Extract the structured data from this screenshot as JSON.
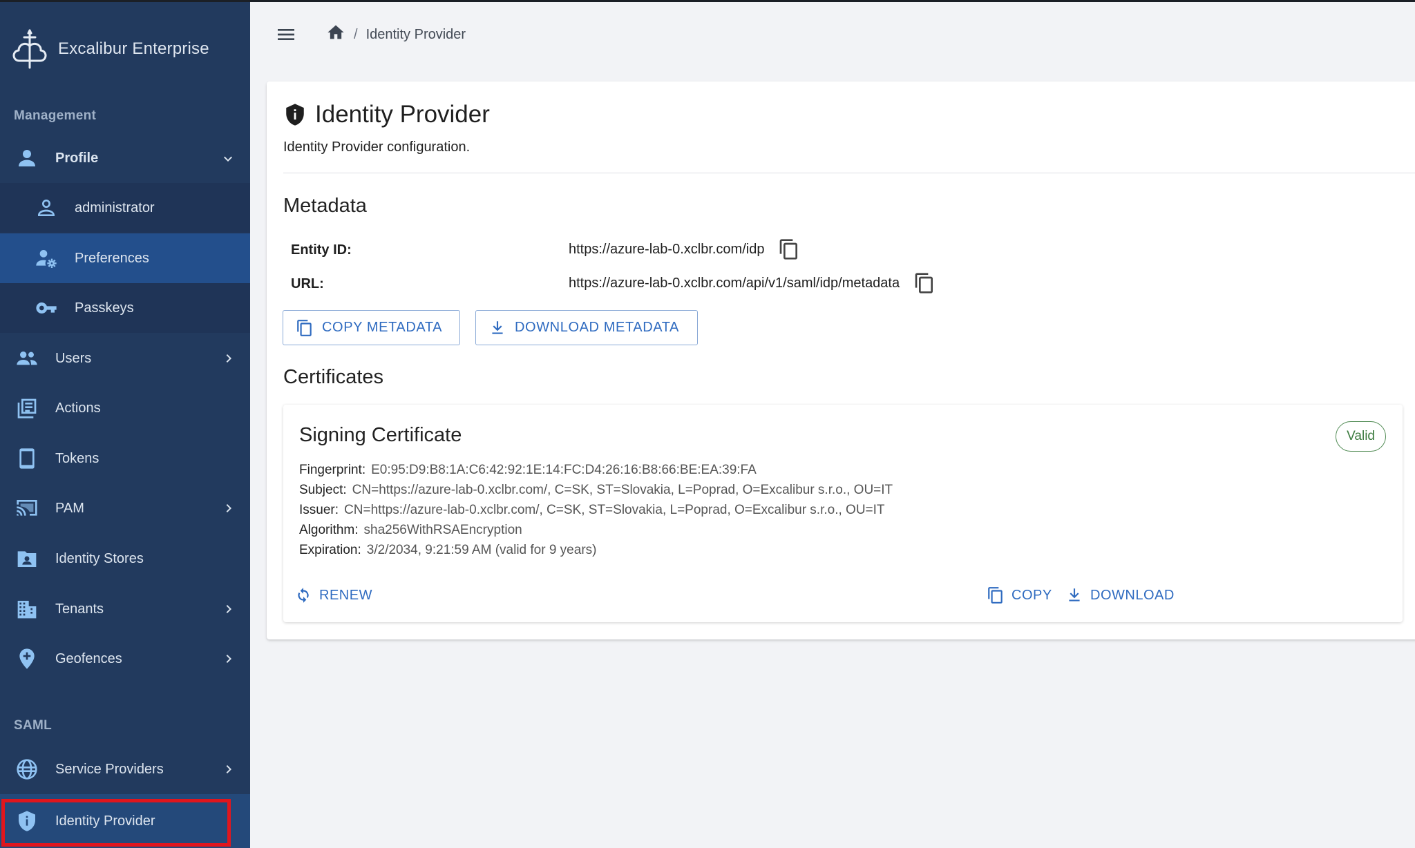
{
  "app": {
    "name": "Excalibur Enterprise"
  },
  "sidebar": {
    "sections": {
      "management": "Management",
      "saml": "SAML"
    },
    "profile": {
      "label": "Profile",
      "children": [
        {
          "label": "administrator",
          "icon": "person-outline-icon"
        },
        {
          "label": "Preferences",
          "icon": "person-settings-icon"
        },
        {
          "label": "Passkeys",
          "icon": "key-icon"
        }
      ]
    },
    "items": [
      {
        "label": "Users",
        "icon": "group-icon"
      },
      {
        "label": "Actions",
        "icon": "list-icon"
      },
      {
        "label": "Tokens",
        "icon": "phone-icon"
      },
      {
        "label": "PAM",
        "icon": "cast-icon"
      },
      {
        "label": "Identity Stores",
        "icon": "folder-user-icon"
      },
      {
        "label": "Tenants",
        "icon": "building-icon"
      },
      {
        "label": "Geofences",
        "icon": "location-icon"
      }
    ],
    "saml_items": [
      {
        "label": "Service Providers",
        "icon": "globe-icon"
      },
      {
        "label": "Identity Provider",
        "icon": "shield-icon"
      }
    ]
  },
  "breadcrumb": {
    "current": "Identity Provider"
  },
  "page": {
    "title": "Identity Provider",
    "description": "Identity Provider configuration."
  },
  "metadata": {
    "heading": "Metadata",
    "entity_id_label": "Entity ID:",
    "entity_id": "https://azure-lab-0.xclbr.com/idp",
    "url_label": "URL:",
    "url": "https://azure-lab-0.xclbr.com/api/v1/saml/idp/metadata",
    "copy_button": "COPY METADATA",
    "download_button": "DOWNLOAD METADATA"
  },
  "certificates": {
    "heading": "Certificates",
    "signing": {
      "title": "Signing Certificate",
      "status": "Valid",
      "status_color": "#3a7a3d",
      "fingerprint_label": "Fingerprint:",
      "fingerprint": "E0:95:D9:B8:1A:C6:42:92:1E:14:FC:D4:26:16:B8:66:BE:EA:39:FA",
      "subject_label": "Subject:",
      "subject": "CN=https://azure-lab-0.xclbr.com/, C=SK, ST=Slovakia, L=Poprad, O=Excalibur s.r.o., OU=IT",
      "issuer_label": "Issuer:",
      "issuer": "CN=https://azure-lab-0.xclbr.com/, C=SK, ST=Slovakia, L=Poprad, O=Excalibur s.r.o., OU=IT",
      "algorithm_label": "Algorithm:",
      "algorithm": "sha256WithRSAEncryption",
      "expiration_label": "Expiration:",
      "expiration": "3/2/2034, 9:21:59 AM (valid for 9 years)",
      "renew_button": "RENEW",
      "copy_button": "COPY",
      "download_button": "DOWNLOAD"
    }
  },
  "colors": {
    "sidebar": "#223a5e",
    "accent": "#2f6bc0",
    "highlight": "#e0161d"
  }
}
